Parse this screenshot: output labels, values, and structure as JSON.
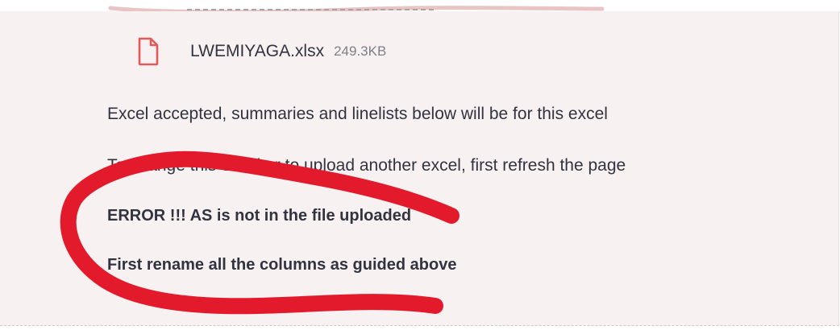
{
  "uploaded_file": {
    "icon": "file-icon",
    "name": "LWEMIYAGA.xlsx",
    "size": "249.3KB"
  },
  "messages": {
    "accepted": "Excel accepted, summaries and linelists below will be for this excel",
    "change_hint": "To change this excel or to upload another excel, first refresh the page",
    "error": "ERROR !!! AS is not in the file uploaded",
    "rename": "First rename all the columns as guided above"
  },
  "colors": {
    "panel_bg": "#f8f1f1",
    "text": "#31333f",
    "muted": "#7d7f87",
    "icon": "#e05a5a",
    "annotation": "#e21a2c"
  }
}
